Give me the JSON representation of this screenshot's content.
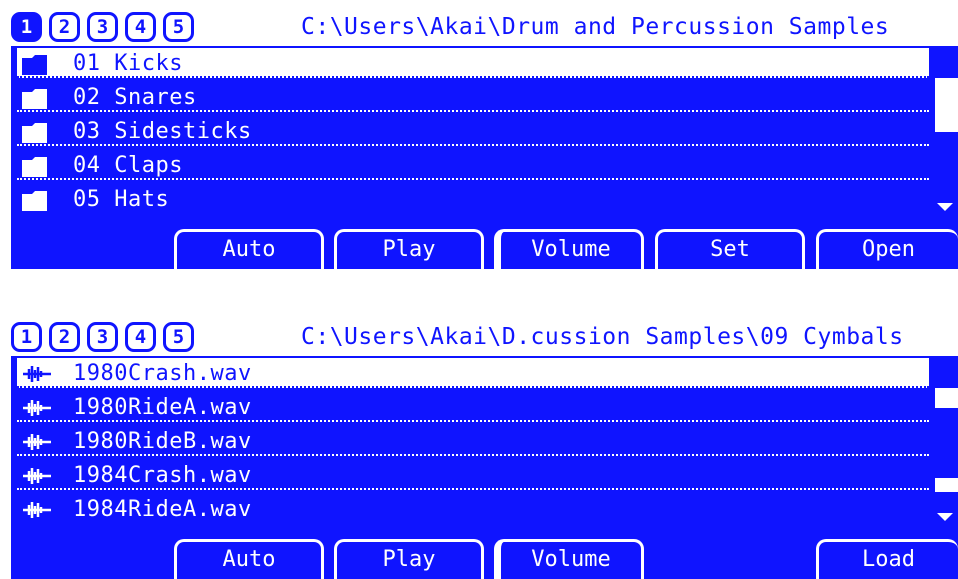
{
  "colors": {
    "accent": "#0f14ff",
    "text_on_accent": "#ffffff",
    "background": "#ffffff"
  },
  "screens": [
    {
      "tabs": [
        {
          "label": "1"
        },
        {
          "label": "2"
        },
        {
          "label": "3"
        },
        {
          "label": "4"
        },
        {
          "label": "5"
        }
      ],
      "active_tab": 1,
      "path": "C:\\Users\\Akai\\Drum and Percussion Samples",
      "item_icon": "folder-icon",
      "items": [
        {
          "label": "01 Kicks",
          "selected": true
        },
        {
          "label": "02 Snares",
          "selected": false
        },
        {
          "label": "03 Sidesticks",
          "selected": false
        },
        {
          "label": "04 Claps",
          "selected": false
        },
        {
          "label": "05 Hats",
          "selected": false
        }
      ],
      "buttons": [
        {
          "label": "Auto"
        },
        {
          "label": "Play"
        },
        {
          "label": "Volume"
        },
        {
          "label": "Set"
        },
        {
          "label": "Open"
        }
      ]
    },
    {
      "tabs": [
        {
          "label": "1"
        },
        {
          "label": "2"
        },
        {
          "label": "3"
        },
        {
          "label": "4"
        },
        {
          "label": "5"
        }
      ],
      "active_tab": null,
      "path": "C:\\Users\\Akai\\D.cussion Samples\\09 Cymbals",
      "item_icon": "audio-file-icon",
      "items": [
        {
          "label": "1980Crash.wav",
          "selected": true
        },
        {
          "label": "1980RideA.wav",
          "selected": false
        },
        {
          "label": "1980RideB.wav",
          "selected": false
        },
        {
          "label": "1984Crash.wav",
          "selected": false
        },
        {
          "label": "1984RideA.wav",
          "selected": false
        }
      ],
      "buttons": [
        {
          "label": "Auto"
        },
        {
          "label": "Play"
        },
        {
          "label": "Volume"
        },
        {
          "label": ""
        },
        {
          "label": "Load"
        }
      ]
    }
  ]
}
